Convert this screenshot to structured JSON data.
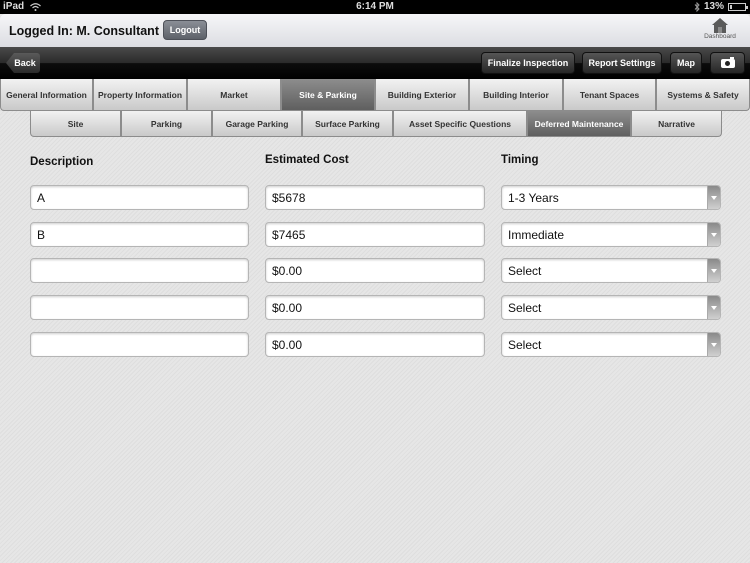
{
  "statusbar": {
    "device": "iPad",
    "time": "6:14 PM",
    "battery": "13%",
    "battery_level": 0.13
  },
  "header": {
    "login_text": "Logged In: M. Consultant",
    "logout_label": "Logout",
    "dashboard_label": "Dashboard"
  },
  "toolbar": {
    "back_label": "Back",
    "finalize_label": "Finalize Inspection",
    "report_settings_label": "Report Settings",
    "map_label": "Map",
    "camera_icon": "camera-icon"
  },
  "main_tabs": [
    {
      "label": "General Information",
      "active": false
    },
    {
      "label": "Property Information",
      "active": false
    },
    {
      "label": "Market",
      "active": false
    },
    {
      "label": "Site & Parking",
      "active": true
    },
    {
      "label": "Building Exterior",
      "active": false
    },
    {
      "label": "Building Interior",
      "active": false
    },
    {
      "label": "Tenant Spaces",
      "active": false
    },
    {
      "label": "Systems & Safety",
      "active": false
    }
  ],
  "sub_tabs": [
    {
      "label": "Site",
      "active": false
    },
    {
      "label": "Parking",
      "active": false
    },
    {
      "label": "Garage Parking",
      "active": false
    },
    {
      "label": "Surface Parking",
      "active": false
    },
    {
      "label": "Asset Specific Questions",
      "active": false
    },
    {
      "label": "Deferred Maintenance",
      "active": true
    },
    {
      "label": "Narrative",
      "active": false
    }
  ],
  "columns": {
    "description": "Description",
    "cost": "Estimated Cost",
    "timing": "Timing"
  },
  "rows": [
    {
      "description": "A",
      "cost": "$5678",
      "timing": "1-3 Years"
    },
    {
      "description": "B",
      "cost": "$7465",
      "timing": "Immediate"
    },
    {
      "description": "",
      "cost": "$0.00",
      "timing": "Select"
    },
    {
      "description": "",
      "cost": "$0.00",
      "timing": "Select"
    },
    {
      "description": "",
      "cost": "$0.00",
      "timing": "Select"
    }
  ]
}
